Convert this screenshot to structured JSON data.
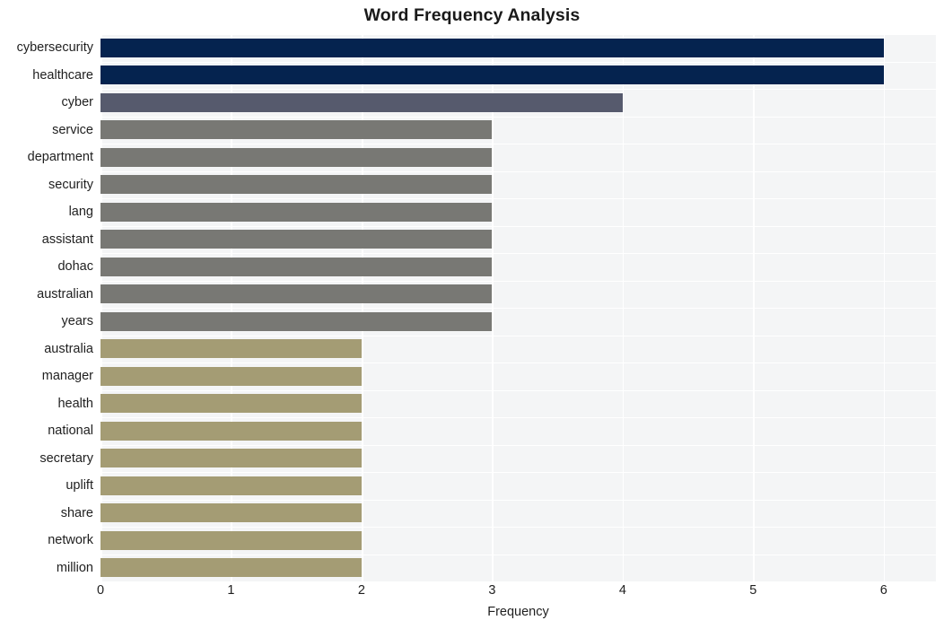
{
  "chart_data": {
    "type": "bar",
    "orientation": "horizontal",
    "title": "Word Frequency Analysis",
    "xlabel": "Frequency",
    "ylabel": "",
    "xlim": [
      0,
      6.4
    ],
    "xticks": [
      0,
      1,
      2,
      3,
      4,
      5,
      6
    ],
    "xtick_labels": [
      "0",
      "1",
      "2",
      "3",
      "4",
      "5",
      "6"
    ],
    "grid": true,
    "legend": false,
    "categories": [
      "cybersecurity",
      "healthcare",
      "cyber",
      "service",
      "department",
      "security",
      "lang",
      "assistant",
      "dohac",
      "australian",
      "years",
      "australia",
      "manager",
      "health",
      "national",
      "secretary",
      "uplift",
      "share",
      "network",
      "million"
    ],
    "values": [
      6,
      6,
      4,
      3,
      3,
      3,
      3,
      3,
      3,
      3,
      3,
      2,
      2,
      2,
      2,
      2,
      2,
      2,
      2,
      2
    ],
    "bar_colors": [
      "#05234f",
      "#05234f",
      "#565a6d",
      "#787874",
      "#787874",
      "#787874",
      "#787874",
      "#787874",
      "#787874",
      "#787874",
      "#787874",
      "#a49c74",
      "#a49c74",
      "#a49c74",
      "#a49c74",
      "#a49c74",
      "#a49c74",
      "#a49c74",
      "#a49c74",
      "#a49c74"
    ],
    "plot_background": "#f4f5f6",
    "grid_color": "#ffffff",
    "figure_background": "#ffffff"
  }
}
